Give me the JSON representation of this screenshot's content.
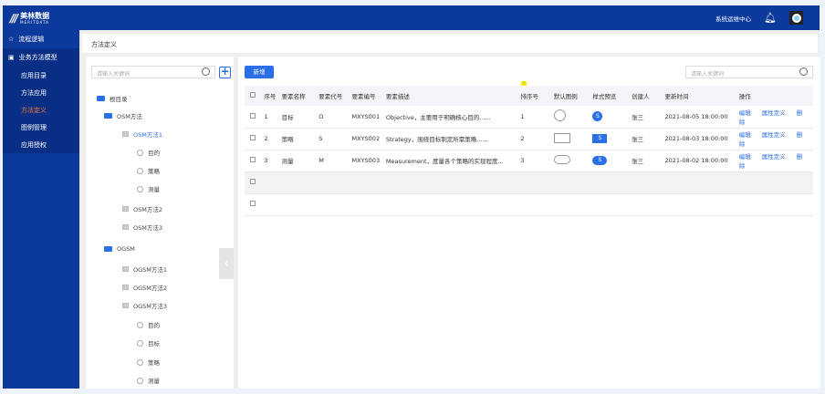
{
  "header": {
    "logo_cn": "美林数据",
    "logo_en": "MERITDATA",
    "ops_center": "系统运维中心"
  },
  "sidebar": {
    "items": [
      {
        "label": "流程逻辑"
      },
      {
        "label": "业务方法模型"
      }
    ],
    "sub": [
      {
        "label": "应用目录"
      },
      {
        "label": "方法应用"
      },
      {
        "label": "方法定义",
        "active": true
      },
      {
        "label": "图例管理"
      },
      {
        "label": "应用授权"
      }
    ]
  },
  "breadcrumb": "方法定义",
  "tree": {
    "search_placeholder": "请输入关键词",
    "nodes": [
      "根目录",
      "OSM方法",
      "OSM方法1",
      "目的",
      "策略",
      "测量",
      "OSM方法2",
      "OSM方法3",
      "OGSM",
      "OGSM方法1",
      "OGSM方法2",
      "OGSM方法3",
      "目的",
      "目标",
      "策略",
      "测量"
    ]
  },
  "main": {
    "add_label": "新增",
    "search_placeholder": "请输入关键词",
    "badge": "!",
    "columns": [
      "序号",
      "要素名称",
      "要素代号",
      "要素编号",
      "要素描述",
      "排序号",
      "默认图例",
      "样式预览",
      "创建人",
      "更新时间",
      "操作"
    ],
    "rows": [
      {
        "no": "1",
        "name": "目标",
        "code": "O",
        "id": "MXYS001",
        "desc": "Objective，主要用于明确核心目的......",
        "sort": "1",
        "legend": "circle",
        "preview": "S",
        "creator": "张三",
        "time": "2021-08-05 18:00:00"
      },
      {
        "no": "2",
        "name": "策略",
        "code": "S",
        "id": "MXYS002",
        "desc": "Strategy，围绕目标制定所需策略......",
        "sort": "2",
        "legend": "rectangle",
        "preview": "S",
        "creator": "张三",
        "time": "2021-08-03 18:00:00"
      },
      {
        "no": "3",
        "name": "测量",
        "code": "M",
        "id": "MXYS003",
        "desc": "Measurement，度量各个策略的实现程度...",
        "sort": "3",
        "legend": "rounded-rectangle",
        "preview": "S",
        "creator": "张三",
        "time": "2021-08-02 18:00:00"
      }
    ],
    "actions": [
      "编辑",
      "属性定义",
      "删除"
    ]
  },
  "colors": {
    "primary": "#0c3a9c",
    "accent": "#2a6fe6",
    "active": "#ff7a30"
  }
}
